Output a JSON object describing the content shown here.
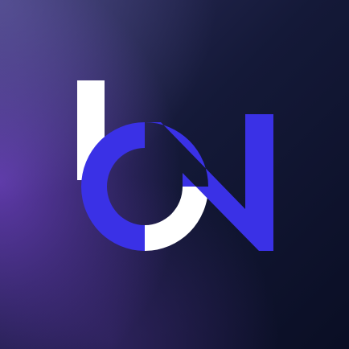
{
  "icon": {
    "name": "bn-logo-icon",
    "colors": {
      "background_dark": "#0b1027",
      "background_mid": "#141938",
      "glow_purple": "#7040c4",
      "glow_lavender": "#6e68b2",
      "accent_blue": "#3a31e6",
      "white": "#ffffff"
    }
  }
}
